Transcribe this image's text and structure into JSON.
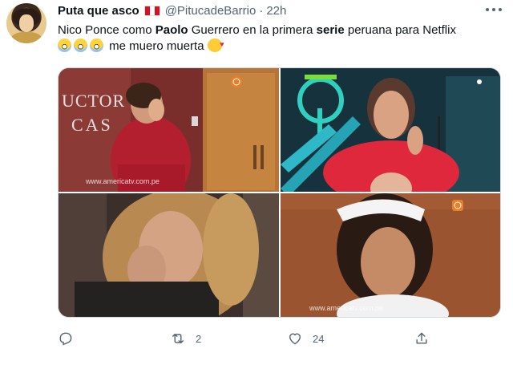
{
  "tweet": {
    "author_name": "Puta que asco",
    "handle": "@PitucadeBarrio",
    "separator": "·",
    "time": "22h",
    "text": {
      "part1": "Nico Ponce como ",
      "bold1": "Paolo",
      "part2": " Guerrero en la primera ",
      "bold2": "serie",
      "part3": " peruana para Netflix",
      "line2": "me muero muerta"
    },
    "media": {
      "watermark_1": "www.americatv.com.pe",
      "watermark_4": "www.americatv.com.pe",
      "sign_text_1": "UCTOR",
      "sign_text_2": "CAS"
    },
    "actions": {
      "reply_count": "",
      "retweet_count": "2",
      "like_count": "24"
    }
  }
}
